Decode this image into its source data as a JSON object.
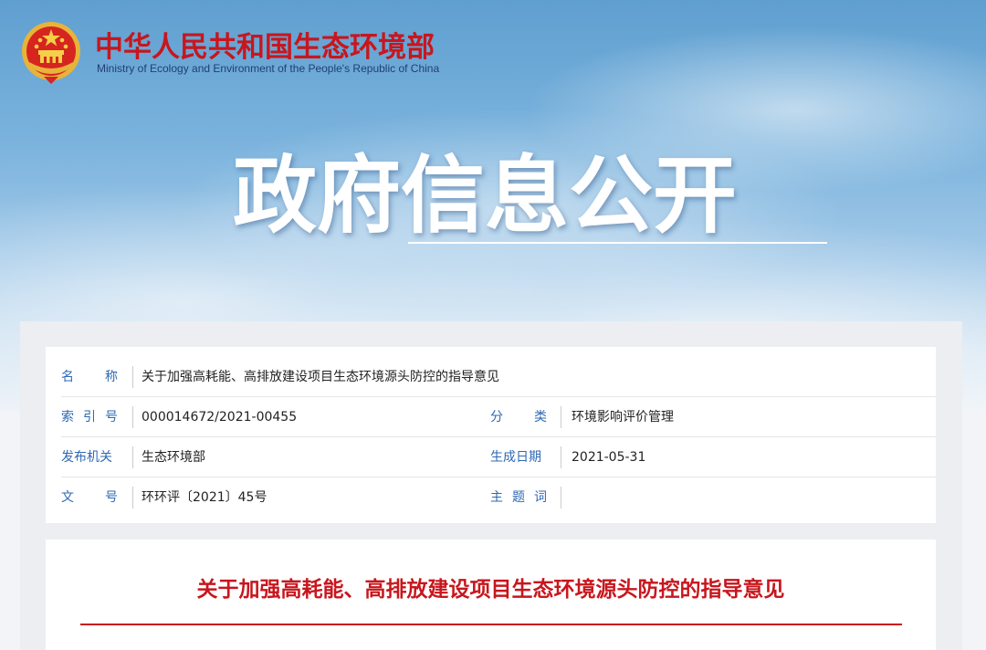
{
  "header": {
    "ministry_name_cn": "中华人民共和国生态环境部",
    "ministry_name_en": "Ministry of Ecology and Environment of the People's Republic of China",
    "emblem_icon": "national-emblem-icon"
  },
  "hero": {
    "title": "政府信息公开"
  },
  "info": {
    "name_label": [
      "名",
      "称"
    ],
    "name_value": "关于加强高耗能、高排放建设项目生态环境源头防控的指导意见",
    "index_label": [
      "索",
      "引",
      "号"
    ],
    "index_value": "000014672/2021-00455",
    "category_label": [
      "分",
      "类"
    ],
    "category_value": "环境影响评价管理",
    "issuer_label": "发布机关",
    "issuer_value": "生态环境部",
    "date_label": "生成日期",
    "date_value": "2021-05-31",
    "docno_label": [
      "文",
      "号"
    ],
    "docno_value": "环环评〔2021〕45号",
    "subject_label": [
      "主",
      "题",
      "词"
    ],
    "subject_value": ""
  },
  "document": {
    "title": "关于加强高耗能、高排放建设项目生态环境源头防控的指导意见"
  },
  "colors": {
    "brand_red": "#c8161d",
    "label_blue": "#2e69b4",
    "text_dark": "#222222"
  }
}
